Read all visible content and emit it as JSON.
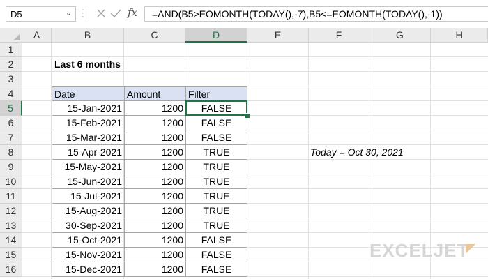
{
  "formula_bar": {
    "name_box": "D5",
    "formula": "=AND(B5>EOMONTH(TODAY(),-7),B5<=EOMONTH(TODAY(),-1))",
    "fx_label": "fx"
  },
  "columns": [
    "A",
    "B",
    "C",
    "D",
    "E",
    "F",
    "G",
    "H"
  ],
  "rows": [
    "1",
    "2",
    "3",
    "4",
    "5",
    "6",
    "7",
    "8",
    "9",
    "10",
    "11",
    "12",
    "13",
    "14",
    "15",
    "16"
  ],
  "selected_cell": "D5",
  "sheet": {
    "title": "Last 6 months",
    "headers": {
      "date": "Date",
      "amount": "Amount",
      "filter": "Filter"
    },
    "data": [
      {
        "date": "15-Jan-2021",
        "amount": "1200",
        "filter": "FALSE"
      },
      {
        "date": "15-Feb-2021",
        "amount": "1200",
        "filter": "FALSE"
      },
      {
        "date": "15-Mar-2021",
        "amount": "1200",
        "filter": "FALSE"
      },
      {
        "date": "15-Apr-2021",
        "amount": "1200",
        "filter": "TRUE"
      },
      {
        "date": "15-May-2021",
        "amount": "1200",
        "filter": "TRUE"
      },
      {
        "date": "15-Jun-2021",
        "amount": "1200",
        "filter": "TRUE"
      },
      {
        "date": "15-Jul-2021",
        "amount": "1200",
        "filter": "TRUE"
      },
      {
        "date": "15-Aug-2021",
        "amount": "1200",
        "filter": "TRUE"
      },
      {
        "date": "30-Sep-2021",
        "amount": "1200",
        "filter": "TRUE"
      },
      {
        "date": "15-Oct-2021",
        "amount": "1200",
        "filter": "FALSE"
      },
      {
        "date": "15-Nov-2021",
        "amount": "1200",
        "filter": "FALSE"
      },
      {
        "date": "15-Dec-2021",
        "amount": "1200",
        "filter": "FALSE"
      }
    ],
    "note": "Today = Oct 30, 2021"
  },
  "watermark": "EXCELJET",
  "colors": {
    "accent": "#217346",
    "header_fill": "#d9e1f2",
    "grid": "#e1e1e1"
  }
}
